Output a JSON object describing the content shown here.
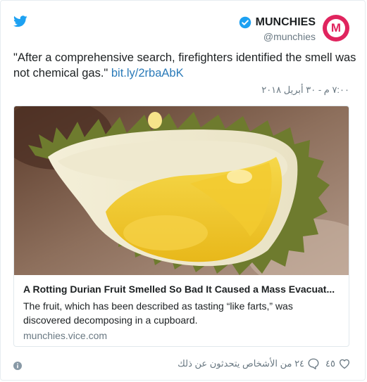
{
  "author": {
    "name": "MUNCHIES",
    "handle": "@munchies",
    "avatar_letter": "M"
  },
  "tweet": {
    "text": "\"After a comprehensive search, firefighters identified the smell was not chemical gas.\"",
    "link": "bit.ly/2rbaAbK",
    "timestamp": "٧:٠٠ م - ٣٠ أبريل ٢٠١٨"
  },
  "link_card": {
    "title": "A Rotting Durian Fruit Smelled So Bad It Caused a Mass Evacuat...",
    "description": "The fruit, which has been described as tasting “like farts,” was discovered decomposing in a cupboard.",
    "domain": "munchies.vice.com"
  },
  "footer": {
    "like_count": "٤٥",
    "reply_text": "٢٤ من الأشخاص يتحدثون عن ذلك"
  },
  "colors": {
    "brand": "#e0245e",
    "link": "#2b7bb9",
    "twitter_blue": "#1da1f2",
    "muted": "#697882"
  },
  "icons": [
    "twitter-bird-icon",
    "verified-badge-icon",
    "info-icon",
    "heart-icon",
    "reply-bubble-icon"
  ]
}
